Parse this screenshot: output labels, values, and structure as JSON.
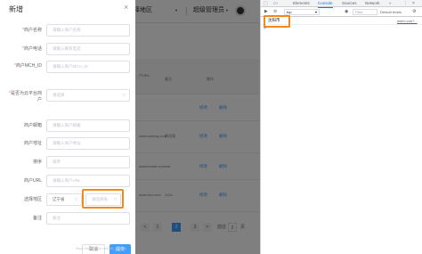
{
  "background": {
    "header_menu_1": "选择地区",
    "header_menu_2": "超级管理员",
    "table_headers": [
      "户URL",
      "备注",
      "操作"
    ],
    "rows": [
      {
        "url": "",
        "note": "",
        "ops": [
          "修改",
          "删除"
        ]
      },
      {
        "url": "www.sadcxg.com",
        "note": "测试测",
        "ops": [
          "修改",
          "删除"
        ]
      },
      {
        "url": "www.bcdcb.com",
        "note": "ssd",
        "ops": [
          "修改",
          "删除"
        ]
      },
      {
        "url": "www.dcn.com",
        "note": "112e",
        "ops": [
          "修改",
          "删除"
        ]
      }
    ],
    "pager": {
      "prev": "<",
      "pages": [
        "1",
        "2",
        "3"
      ],
      "active": "2",
      "next": ">",
      "goto_label": "前往",
      "goto_value": "2",
      "page_unit": "页"
    }
  },
  "dialog": {
    "title": "新增",
    "close": "×",
    "fields": [
      {
        "label": "商户名称",
        "required": true,
        "placeholder": "请输入商户名称"
      },
      {
        "label": "商户电话",
        "required": true,
        "placeholder": "请输入联系电话"
      },
      {
        "label": "商户MCH_ID",
        "required": true,
        "placeholder": "请输入商户MCH_ID"
      },
      {
        "label": "是否为云平台商户",
        "required": true,
        "placeholder": "请选择"
      },
      {
        "label": "商户邮箱",
        "required": false,
        "placeholder": "请输入商户邮箱"
      },
      {
        "label": "商户地址",
        "required": false,
        "placeholder": "请输入商户地址"
      },
      {
        "label": "排序",
        "required": false,
        "placeholder": "排序"
      },
      {
        "label": "商户URL",
        "required": false,
        "placeholder": "请输入商户URL"
      },
      {
        "label": "选择地区",
        "required": false
      },
      {
        "label": "备注",
        "required": false,
        "placeholder": "备注"
      }
    ],
    "province_value": "辽宁省",
    "city_placeholder": "请选择省",
    "cancel": "取消",
    "submit": "提交",
    "highlight_color": "#f08a1c"
  },
  "devtools": {
    "tabs": [
      "Elements",
      "Console",
      "Sources",
      "Network"
    ],
    "active_tab": "Console",
    "more": "»",
    "context": "top",
    "filter_placeholder": "Filter",
    "levels": "Default levels",
    "log_text": "沈阳市",
    "log_source": "index.vue?...",
    "prompt": ">"
  },
  "watermark": "https://blog.csdn.net/m0_4xxxxx"
}
